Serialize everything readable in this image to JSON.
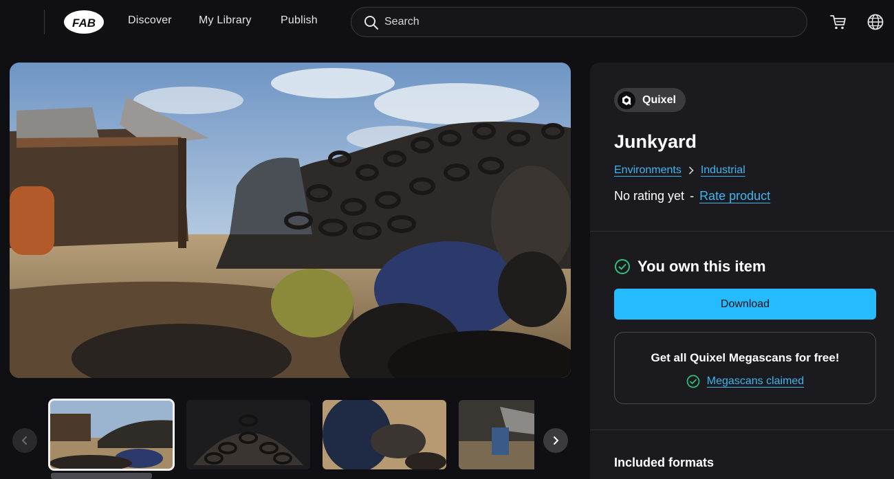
{
  "nav": {
    "brand": "FAB",
    "links": [
      "Discover",
      "My Library",
      "Publish"
    ],
    "search_placeholder": "Search",
    "icons": [
      "cart-icon",
      "globe-icon"
    ]
  },
  "gallery": {
    "hero_alt": "Junkyard scene with piles of tires, barrels and a corrugated shack",
    "thumbnail_count": 4,
    "selected_index": 0
  },
  "product": {
    "publisher": "Quixel",
    "title": "Junkyard",
    "breadcrumbs": [
      "Environments",
      "Industrial"
    ],
    "rating_text": "No rating yet",
    "rating_separator": "-",
    "rate_link": "Rate product",
    "ownership": "You own this item",
    "download_label": "Download",
    "promo_title": "Get all Quixel Megascans for free!",
    "promo_status": "Megascans claimed",
    "formats_heading": "Included formats"
  },
  "colors": {
    "accent": "#26bbff",
    "link": "#3cb7f0",
    "success": "#2ec27e",
    "background": "#101014",
    "panel": "#1b1b1f"
  }
}
